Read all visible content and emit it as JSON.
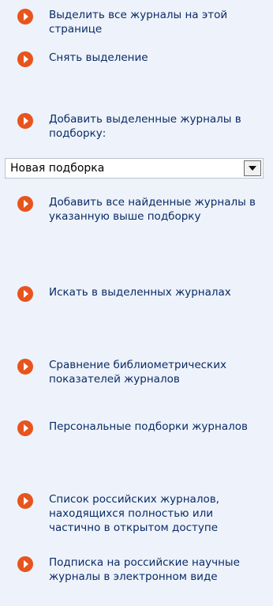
{
  "actions": [
    {
      "id": "select-all",
      "label": "Выделить все журналы на этой странице"
    },
    {
      "id": "deselect",
      "label": "Снять выделение"
    },
    {
      "id": "add-selected",
      "label": "Добавить выделенные журналы в подборку:"
    }
  ],
  "collection_select": {
    "value": "Новая подборка"
  },
  "actions_after_select": [
    {
      "id": "add-all-found",
      "label": "Добавить все найденные журналы в указанную выше подборку"
    },
    {
      "id": "search-selected",
      "label": "Искать в выделенных журналах"
    },
    {
      "id": "compare-metrics",
      "label": "Сравнение библиометрических показателей журналов"
    },
    {
      "id": "personal-collections",
      "label": "Персональные подборки журналов"
    },
    {
      "id": "open-access-list",
      "label": "Список российских журналов, находящихся полностью или частично в открытом доступе"
    },
    {
      "id": "subscription",
      "label": "Подписка на российские научные журналы в электронном виде"
    }
  ],
  "colors": {
    "background": "#eef3fb",
    "link_text": "#0a2a66",
    "bullet_icon": "#e8541d"
  },
  "icons": {
    "bullet": "orange-circle-play-icon",
    "select_arrow": "chevron-down-icon"
  }
}
